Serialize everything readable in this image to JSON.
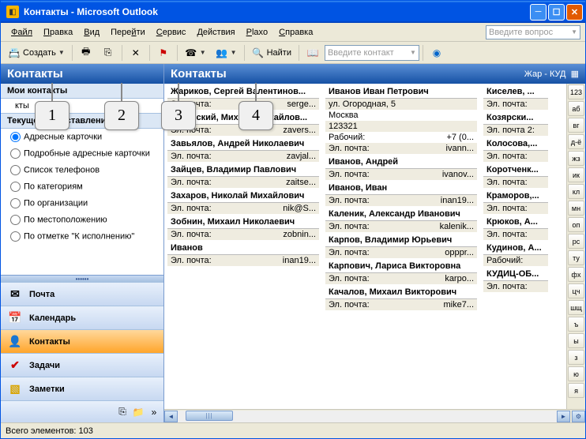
{
  "window": {
    "title": "Контакты - Microsoft Outlook"
  },
  "menu": {
    "file": "Файл",
    "edit": "Правка",
    "view": "Вид",
    "go": "Перейти",
    "service": "Сервис",
    "actions": "Действия",
    "plaxo": "Plaxo",
    "help": "Справка"
  },
  "askbox": {
    "placeholder": "Введите вопрос"
  },
  "toolbar": {
    "create": "Создать",
    "find": "Найти",
    "contact_placeholder": "Введите контакт"
  },
  "nav": {
    "header": "Контакты",
    "mycontacts": "Мои контакты",
    "contacts_item": "кты",
    "currentview": "Текущее представление",
    "views": [
      "Адресные карточки",
      "Подробные адресные карточки",
      "Список телефонов",
      "По категориям",
      "По организации",
      "По местоположению",
      "По отметке \"К исполнению\""
    ],
    "buttons": {
      "mail": "Почта",
      "calendar": "Календарь",
      "contacts": "Контакты",
      "tasks": "Задачи",
      "notes": "Заметки"
    }
  },
  "content": {
    "header": "Контакты",
    "range": "Жар - КУД",
    "labels": {
      "email": "Эл. почта:",
      "work": "Рабочий:"
    },
    "col1": [
      {
        "name": "Жариков, Сергей Валентинов...",
        "rows": [
          [
            "Эл. почта:",
            "serge..."
          ]
        ]
      },
      {
        "name": "Заверский, Михаил Михайлов...",
        "rows": [
          [
            "Эл. почта:",
            "zavers..."
          ]
        ]
      },
      {
        "name": "Завьялов, Андрей Николаевич",
        "rows": [
          [
            "Эл. почта:",
            "zavjal..."
          ]
        ]
      },
      {
        "name": "Зайцев, Владимир Павлович",
        "rows": [
          [
            "Эл. почта:",
            "zaitse..."
          ]
        ]
      },
      {
        "name": "Захаров, Николай Михайлович",
        "rows": [
          [
            "Эл. почта:",
            "nik@S..."
          ]
        ]
      },
      {
        "name": "Зобнин, Михаил Николаевич",
        "rows": [
          [
            "Эл. почта:",
            "zobnin..."
          ]
        ]
      },
      {
        "name": "Иванов",
        "rows": [
          [
            "Эл. почта:",
            "inan19..."
          ]
        ]
      }
    ],
    "col2": [
      {
        "name": "Иванов Иван Петрович",
        "rows": [
          [
            "",
            "ул. Огородная, 5"
          ],
          [
            "",
            "Москва"
          ],
          [
            "",
            "123321"
          ],
          [
            "Рабочий:",
            "+7 (0..."
          ],
          [
            "Эл. почта:",
            "ivann..."
          ]
        ]
      },
      {
        "name": "Иванов, Андрей",
        "rows": [
          [
            "Эл. почта:",
            "ivanov..."
          ]
        ]
      },
      {
        "name": "Иванов, Иван",
        "rows": [
          [
            "Эл. почта:",
            "inan19..."
          ]
        ]
      },
      {
        "name": "Каленик, Александр Иванович",
        "rows": [
          [
            "Эл. почта:",
            "kalenik..."
          ]
        ]
      },
      {
        "name": "Карпов, Владимир Юрьевич",
        "rows": [
          [
            "Эл. почта:",
            "opppr..."
          ]
        ]
      },
      {
        "name": "Карпович, Лариса Викторовна",
        "rows": [
          [
            "Эл. почта:",
            "karpo..."
          ]
        ]
      },
      {
        "name": "Качалов, Михаил Викторович",
        "rows": [
          [
            "Эл. почта:",
            "mike7..."
          ]
        ]
      }
    ],
    "col3": [
      {
        "name": "Киселев, ...",
        "rows": [
          [
            "Эл. почта:",
            ""
          ]
        ]
      },
      {
        "name": "Козярски...",
        "rows": [
          [
            "Эл. почта 2:",
            ""
          ]
        ]
      },
      {
        "name": "Колосова,...",
        "rows": [
          [
            "Эл. почта:",
            ""
          ]
        ]
      },
      {
        "name": "Коротченк...",
        "rows": [
          [
            "Эл. почта:",
            ""
          ]
        ]
      },
      {
        "name": "Краморов,...",
        "rows": [
          [
            "Эл. почта:",
            ""
          ]
        ]
      },
      {
        "name": "Крюков, А...",
        "rows": [
          [
            "Эл. почта:",
            ""
          ]
        ]
      },
      {
        "name": "Кудинов, А...",
        "rows": [
          [
            "Рабочий:",
            ""
          ]
        ]
      },
      {
        "name": "КУДИЦ-ОБ...",
        "rows": [
          [
            "Эл. почта:",
            ""
          ]
        ]
      }
    ]
  },
  "index": [
    "123",
    "аб",
    "вг",
    "д-ё",
    "жз",
    "ик",
    "кл",
    "мн",
    "оп",
    "рс",
    "ту",
    "фх",
    "цч",
    "шщ",
    "ъ",
    "ы",
    "з",
    "ю",
    "я"
  ],
  "status": {
    "count": "Всего элементов: 103"
  },
  "callouts": {
    "c1": "1",
    "c2": "2",
    "c3": "3",
    "c4": "4"
  }
}
